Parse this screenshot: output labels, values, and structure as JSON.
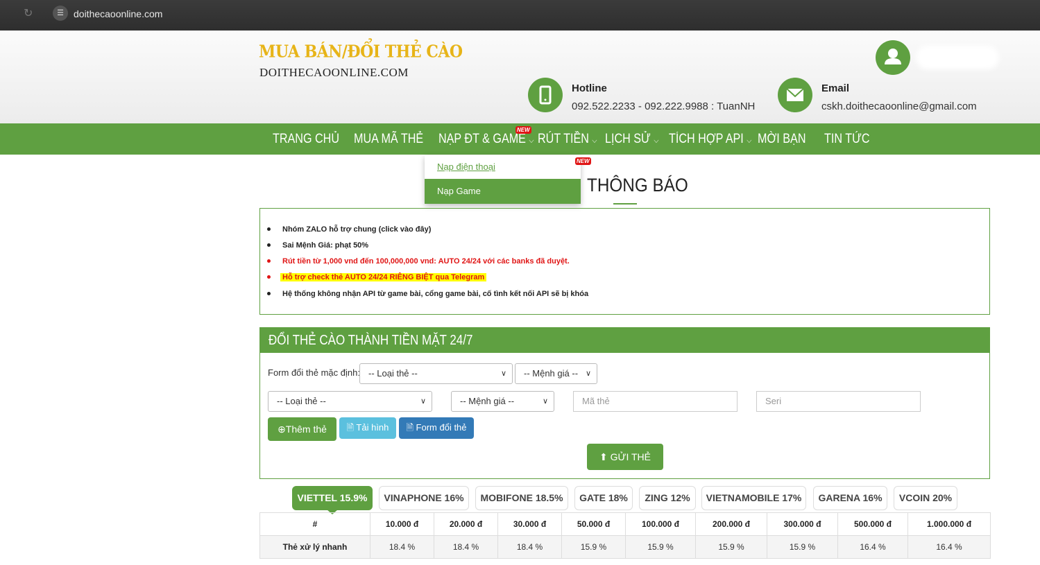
{
  "browser": {
    "url": "doithecaoonline.com"
  },
  "header": {
    "logo_line1": "MUA BÁN/ĐỔI THẺ CÀO",
    "logo_line2": "DOITHECAOONLINE.COM",
    "hotline_label": "Hotline",
    "hotline_value": "092.522.2233 - 092.222.9988 : TuanNH",
    "email_label": "Email",
    "email_value": "cskh.doithecaoonline@gmail.com"
  },
  "nav": {
    "items": [
      "TRANG CHỦ",
      "MUA MÃ THẺ",
      "NẠP ĐT & GAME",
      "RÚT TIỀN",
      "LỊCH SỬ",
      "TÍCH HỢP API",
      "MỜI BẠN",
      "TIN TỨC"
    ],
    "new_badge": "NEW"
  },
  "dropdown": {
    "items": [
      "Nạp điện thoại",
      "Nạp Game"
    ]
  },
  "notice": {
    "title": "THÔNG BÁO",
    "lines": [
      "Nhóm ZALO hỗ trợ chung (click vào đây)",
      "Sai Mệnh Giá: phạt 50%",
      "Rút tiền từ 1,000 vnd đến 100,000,000 vnd: AUTO 24/24 với các banks đã duyệt.",
      "Hỗ trợ check thẻ AUTO 24/24 RIÊNG BIỆT qua Telegram",
      "Hệ thống không nhận API từ game bài, cổng game bài, cố tình kết nối API sẽ bị khóa"
    ]
  },
  "form": {
    "title": "ĐỔI THẺ CÀO THÀNH TIỀN MẶT 24/7",
    "default_label": "Form đổi thẻ mặc định:",
    "card_type": "-- Loại thẻ --",
    "denomination": "-- Mệnh giá --",
    "code_placeholder": "Mã thẻ",
    "serial_placeholder": "Seri",
    "add_button": "Thêm thẻ",
    "file_button": "Tải hình",
    "form_button": "Form đổi thẻ",
    "submit_button": "GỬI THẺ"
  },
  "tabs": [
    "VIETTEL 15.9%",
    "VINAPHONE 16%",
    "MOBIFONE 18.5%",
    "GATE 18%",
    "ZING 12%",
    "VIETNAMOBILE 17%",
    "GARENA 16%",
    "VCOIN 20%"
  ],
  "rate_table": {
    "headers": [
      "#",
      "10.000 đ",
      "20.000 đ",
      "30.000 đ",
      "50.000 đ",
      "100.000 đ",
      "200.000 đ",
      "300.000 đ",
      "500.000 đ",
      "1.000.000 đ"
    ],
    "row": [
      "Thẻ xử lý nhanh",
      "18.4 %",
      "18.4 %",
      "18.4 %",
      "15.9 %",
      "15.9 %",
      "15.9 %",
      "15.9 %",
      "16.4 %",
      "16.4 %"
    ]
  },
  "colors": {
    "brand_green": "#5fa041",
    "logo_gold": "#e7b418",
    "alert_red": "#e01515",
    "highlight": "#ffff00"
  }
}
